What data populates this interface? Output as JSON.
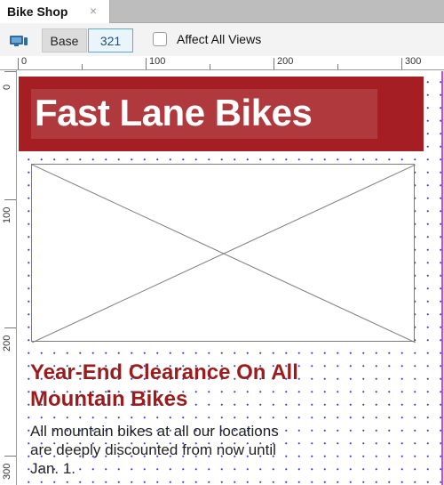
{
  "tab": {
    "title": "Bike Shop",
    "close_glyph": "×"
  },
  "toolbar": {
    "device_icon": "monitor-icon",
    "base_label": "Base",
    "width_value": "321",
    "affect_all_label": "Affect All Views",
    "affect_all_checked": false
  },
  "ruler": {
    "h_labels": [
      "0",
      "100",
      "200",
      "300"
    ],
    "v_labels": [
      "0",
      "100",
      "200",
      "300"
    ]
  },
  "page": {
    "header_title": "Fast Lane Bikes",
    "headline": "Year-End Clearance On All Mountain Bikes",
    "body": "All mountain bikes at all our locations are deeply discounted from now until Jan. 1.",
    "image_placeholder": "image-placeholder"
  },
  "colors": {
    "header_bg": "#a51e24",
    "headline": "#9b1c1c",
    "guide": "#e43be4",
    "grid_dots": "#3b3bdc",
    "width_box_border": "#5aa9d6"
  }
}
